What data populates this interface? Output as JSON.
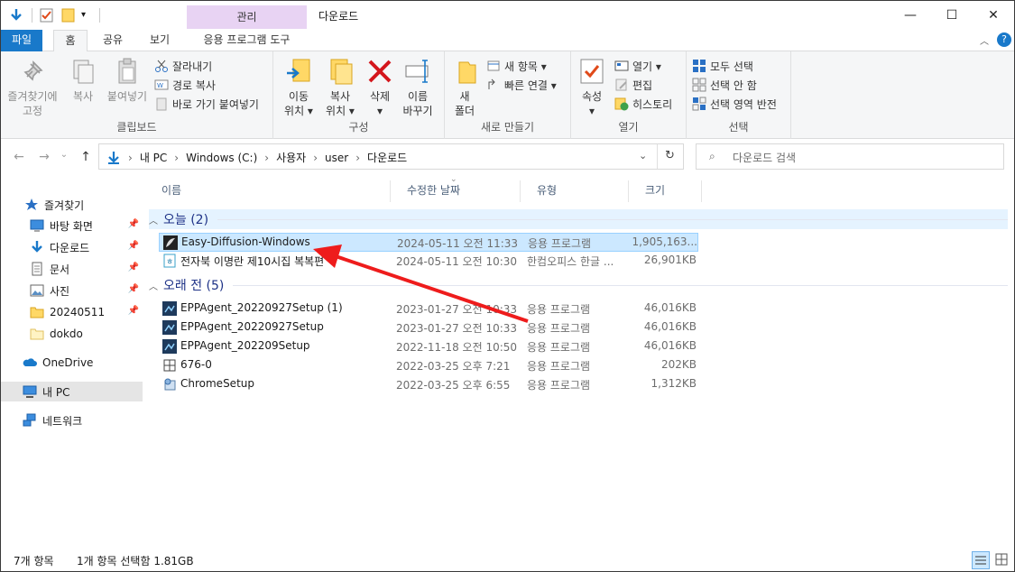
{
  "window": {
    "title": "다운로드",
    "context_tab": "관리",
    "context_subtab": "응용 프로그램 도구",
    "controls": {
      "minimize": "—",
      "maximize": "☐",
      "close": "✕"
    }
  },
  "tabs": {
    "file": "파일",
    "home": "홈",
    "share": "공유",
    "view": "보기"
  },
  "ribbon": {
    "clipboard": {
      "pin_label": "즐겨찾기에\n고정",
      "copy_label": "복사",
      "paste_label": "붙여넣기",
      "cut_label": "잘라내기",
      "copy_path_label": "경로 복사",
      "paste_shortcut_label": "바로 가기 붙여넣기",
      "group_label": "클립보드"
    },
    "organize": {
      "move_label": "이동\n위치 ▾",
      "copyto_label": "복사\n위치 ▾",
      "delete_label": "삭제\n▾",
      "rename_label": "이름\n바꾸기",
      "group_label": "구성"
    },
    "new": {
      "folder_label": "새\n폴더",
      "new_item_label": "새 항목 ▾",
      "easy_access_label": "빠른 연결 ▾",
      "group_label": "새로 만들기"
    },
    "open": {
      "properties_label": "속성\n▾",
      "open_label": "열기 ▾",
      "edit_label": "편집",
      "history_label": "히스토리",
      "group_label": "열기"
    },
    "select": {
      "select_all_label": "모두 선택",
      "select_none_label": "선택 안 함",
      "invert_label": "선택 영역 반전",
      "group_label": "선택"
    }
  },
  "address": {
    "crumbs": [
      "내 PC",
      "Windows (C:)",
      "사용자",
      "user",
      "다운로드"
    ],
    "search_placeholder": "다운로드 검색"
  },
  "nav": {
    "quick_access": "즐겨찾기",
    "items": [
      {
        "label": "바탕 화면",
        "icon": "desktop-icon"
      },
      {
        "label": "다운로드",
        "icon": "download-icon"
      },
      {
        "label": "문서",
        "icon": "document-icon"
      },
      {
        "label": "사진",
        "icon": "pictures-icon"
      },
      {
        "label": "20240511",
        "icon": "folder-icon"
      },
      {
        "label": "dokdo",
        "icon": "folder-icon"
      }
    ],
    "onedrive": "OneDrive",
    "this_pc": "내 PC",
    "network": "네트워크"
  },
  "columns": {
    "name": "이름",
    "modified": "수정한 날짜",
    "type": "유형",
    "size": "크기"
  },
  "groups": {
    "today": {
      "label": "오늘 (2)",
      "rows": [
        {
          "name": "Easy-Diffusion-Windows",
          "date": "2024-05-11 오전 11:33",
          "type": "응용 프로그램",
          "size": "1,905,163...",
          "icon": "easy-diffusion-icon"
        },
        {
          "name": "전자북 이명란 제10시집 복복편",
          "date": "2024-05-11 오전 10:30",
          "type": "한컴오피스 한글 ...",
          "size": "26,901KB",
          "icon": "hwp-document-icon"
        }
      ]
    },
    "earlier": {
      "label": "오래 전 (5)",
      "rows": [
        {
          "name": "EPPAgent_20220927Setup (1)",
          "date": "2023-01-27 오전 10:33",
          "type": "응용 프로그램",
          "size": "46,016KB",
          "icon": "installer-icon"
        },
        {
          "name": "EPPAgent_20220927Setup",
          "date": "2023-01-27 오전 10:33",
          "type": "응용 프로그램",
          "size": "46,016KB",
          "icon": "installer-icon"
        },
        {
          "name": "EPPAgent_202209Setup",
          "date": "2022-11-18 오전 10:50",
          "type": "응용 프로그램",
          "size": "46,016KB",
          "icon": "installer-icon"
        },
        {
          "name": "676-0",
          "date": "2022-03-25 오후 7:21",
          "type": "응용 프로그램",
          "size": "202KB",
          "icon": "package-icon"
        },
        {
          "name": "ChromeSetup",
          "date": "2022-03-25 오후 6:55",
          "type": "응용 프로그램",
          "size": "1,312KB",
          "icon": "setup-icon"
        }
      ]
    }
  },
  "status": {
    "count": "7개 항목",
    "selection": "1개 항목 선택함 1.81GB"
  },
  "colors": {
    "accent": "#1979ca",
    "selection": "#cce8ff",
    "annotation_arrow": "#ee1c1c",
    "context_tab": "#e8d3f3"
  }
}
